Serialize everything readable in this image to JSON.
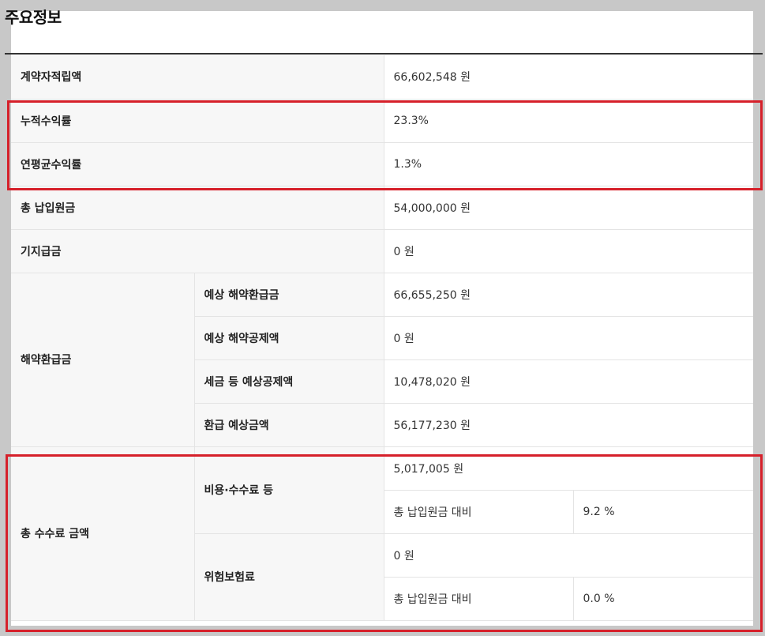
{
  "section_title": "주요정보",
  "rows": {
    "contract_reserve": {
      "label": "계약자적립액",
      "value": "66,602,548 원"
    },
    "cumulative_return": {
      "label": "누적수익률",
      "value": "23.3%"
    },
    "annual_return": {
      "label": "연평균수익률",
      "value": "1.3%"
    },
    "total_principal": {
      "label": "총 납입원금",
      "value": "54,000,000 원"
    },
    "paid_amount": {
      "label": "기지급금",
      "value": "0 원"
    },
    "surrender": {
      "label": "해약환급금",
      "items": [
        {
          "label": "예상 해약환급금",
          "value": "66,655,250 원"
        },
        {
          "label": "예상 해약공제액",
          "value": "0 원"
        },
        {
          "label": "세금 등 예상공제액",
          "value": "10,478,020 원"
        },
        {
          "label": "환급 예상금액",
          "value": "56,177,230 원"
        }
      ]
    },
    "total_fee": {
      "label": "총 수수료 금액",
      "cost_fee": {
        "label": "비용·수수료 등",
        "value": "5,017,005 원",
        "ratio_label": "총 납입원금 대비",
        "ratio_value": "9.2 %"
      },
      "risk_premium": {
        "label": "위험보험료",
        "value": "0 원",
        "ratio_label": "총 납입원금 대비",
        "ratio_value": "0.0 %"
      }
    }
  },
  "highlight_color": "#d6202a"
}
